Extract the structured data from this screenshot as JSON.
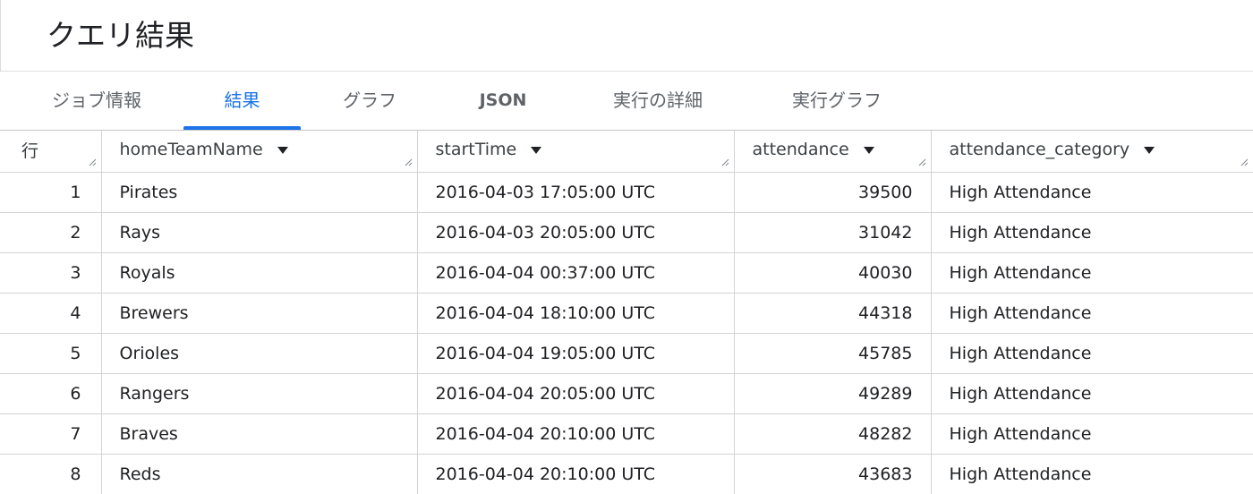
{
  "header": {
    "title": "クエリ結果"
  },
  "tabs": [
    {
      "label": "ジョブ情報",
      "active": false
    },
    {
      "label": "結果",
      "active": true
    },
    {
      "label": "グラフ",
      "active": false
    },
    {
      "label": "JSON",
      "active": false
    },
    {
      "label": "実行の詳細",
      "active": false
    },
    {
      "label": "実行グラフ",
      "active": false
    }
  ],
  "table": {
    "columns": [
      {
        "label": "行"
      },
      {
        "label": "homeTeamName"
      },
      {
        "label": "startTime"
      },
      {
        "label": "attendance"
      },
      {
        "label": "attendance_category"
      }
    ],
    "rows": [
      {
        "row": "1",
        "homeTeamName": "Pirates",
        "startTime": "2016-04-03 17:05:00 UTC",
        "attendance": "39500",
        "attendance_category": "High Attendance"
      },
      {
        "row": "2",
        "homeTeamName": "Rays",
        "startTime": "2016-04-03 20:05:00 UTC",
        "attendance": "31042",
        "attendance_category": "High Attendance"
      },
      {
        "row": "3",
        "homeTeamName": "Royals",
        "startTime": "2016-04-04 00:37:00 UTC",
        "attendance": "40030",
        "attendance_category": "High Attendance"
      },
      {
        "row": "4",
        "homeTeamName": "Brewers",
        "startTime": "2016-04-04 18:10:00 UTC",
        "attendance": "44318",
        "attendance_category": "High Attendance"
      },
      {
        "row": "5",
        "homeTeamName": "Orioles",
        "startTime": "2016-04-04 19:05:00 UTC",
        "attendance": "45785",
        "attendance_category": "High Attendance"
      },
      {
        "row": "6",
        "homeTeamName": "Rangers",
        "startTime": "2016-04-04 20:05:00 UTC",
        "attendance": "49289",
        "attendance_category": "High Attendance"
      },
      {
        "row": "7",
        "homeTeamName": "Braves",
        "startTime": "2016-04-04 20:10:00 UTC",
        "attendance": "48282",
        "attendance_category": "High Attendance"
      },
      {
        "row": "8",
        "homeTeamName": "Reds",
        "startTime": "2016-04-04 20:10:00 UTC",
        "attendance": "43683",
        "attendance_category": "High Attendance"
      }
    ]
  },
  "colors": {
    "accent": "#1a73e8",
    "tab_inactive": "#5f6368",
    "grid_line": "#d4d4d4"
  }
}
